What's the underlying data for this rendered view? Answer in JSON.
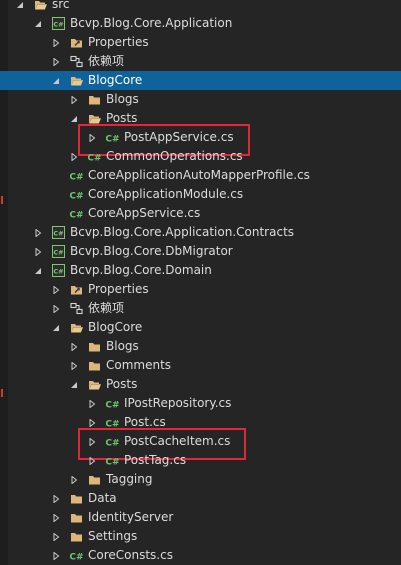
{
  "tree": [
    {
      "label": "src",
      "depth": 0,
      "icon": "folder-open",
      "arrow": "expanded"
    },
    {
      "label": "Bcvp.Blog.Core.Application",
      "depth": 1,
      "icon": "csproj",
      "arrow": "expanded"
    },
    {
      "label": "Properties",
      "depth": 2,
      "icon": "wrench-folder",
      "arrow": "collapsed"
    },
    {
      "label": "依赖项",
      "depth": 2,
      "icon": "dependencies",
      "arrow": "collapsed"
    },
    {
      "label": "BlogCore",
      "depth": 2,
      "icon": "folder-open",
      "arrow": "expanded",
      "selected": true
    },
    {
      "label": "Blogs",
      "depth": 3,
      "icon": "folder",
      "arrow": "collapsed"
    },
    {
      "label": "Posts",
      "depth": 3,
      "icon": "folder-open",
      "arrow": "expanded"
    },
    {
      "label": "PostAppService.cs",
      "depth": 4,
      "icon": "csharp",
      "arrow": "collapsed",
      "highlight": true
    },
    {
      "label": "CommonOperations.cs",
      "depth": 3,
      "icon": "csharp",
      "arrow": "collapsed"
    },
    {
      "label": "CoreApplicationAutoMapperProfile.cs",
      "depth": 2,
      "icon": "csharp",
      "arrow": "none"
    },
    {
      "label": "CoreApplicationModule.cs",
      "depth": 2,
      "icon": "csharp",
      "arrow": "none"
    },
    {
      "label": "CoreAppService.cs",
      "depth": 2,
      "icon": "csharp",
      "arrow": "none"
    },
    {
      "label": "Bcvp.Blog.Core.Application.Contracts",
      "depth": 1,
      "icon": "csproj",
      "arrow": "collapsed"
    },
    {
      "label": "Bcvp.Blog.Core.DbMigrator",
      "depth": 1,
      "icon": "csproj",
      "arrow": "collapsed"
    },
    {
      "label": "Bcvp.Blog.Core.Domain",
      "depth": 1,
      "icon": "csproj",
      "arrow": "expanded"
    },
    {
      "label": "Properties",
      "depth": 2,
      "icon": "wrench-folder",
      "arrow": "collapsed"
    },
    {
      "label": "依赖项",
      "depth": 2,
      "icon": "dependencies",
      "arrow": "collapsed"
    },
    {
      "label": "BlogCore",
      "depth": 2,
      "icon": "folder-open",
      "arrow": "expanded"
    },
    {
      "label": "Blogs",
      "depth": 3,
      "icon": "folder",
      "arrow": "collapsed"
    },
    {
      "label": "Comments",
      "depth": 3,
      "icon": "folder",
      "arrow": "collapsed"
    },
    {
      "label": "Posts",
      "depth": 3,
      "icon": "folder-open",
      "arrow": "expanded"
    },
    {
      "label": "IPostRepository.cs",
      "depth": 4,
      "icon": "csharp",
      "arrow": "collapsed"
    },
    {
      "label": "Post.cs",
      "depth": 4,
      "icon": "csharp",
      "arrow": "collapsed"
    },
    {
      "label": "PostCacheItem.cs",
      "depth": 4,
      "icon": "csharp",
      "arrow": "collapsed",
      "highlight": true
    },
    {
      "label": "PostTag.cs",
      "depth": 4,
      "icon": "csharp",
      "arrow": "collapsed"
    },
    {
      "label": "Tagging",
      "depth": 3,
      "icon": "folder",
      "arrow": "collapsed"
    },
    {
      "label": "Data",
      "depth": 2,
      "icon": "folder",
      "arrow": "collapsed"
    },
    {
      "label": "IdentityServer",
      "depth": 2,
      "icon": "folder",
      "arrow": "collapsed"
    },
    {
      "label": "Settings",
      "depth": 2,
      "icon": "folder",
      "arrow": "collapsed"
    },
    {
      "label": "CoreConsts.cs",
      "depth": 2,
      "icon": "csharp",
      "arrow": "collapsed"
    }
  ],
  "colors": {
    "background": "#252526",
    "selection": "#0e639c",
    "folder": "#dcb67a",
    "csharp": "#6ec76e",
    "highlight_box": "#e0283b"
  }
}
